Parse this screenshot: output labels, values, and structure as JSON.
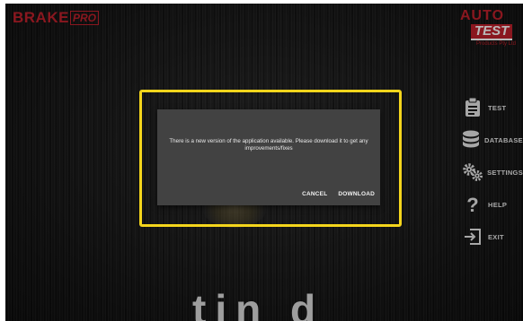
{
  "header": {
    "brand_main": "BRAKE",
    "brand_box": "PRO",
    "company": {
      "line1": "AUTO",
      "line2": "TEST",
      "line3": "Products Pty Ltd"
    }
  },
  "menu": [
    {
      "icon": "clipboard-icon",
      "label": "TEST"
    },
    {
      "icon": "database-icon",
      "label": "DATABASE"
    },
    {
      "icon": "gears-icon",
      "label": "SETTINGS"
    },
    {
      "icon": "question-icon",
      "label": "HELP"
    },
    {
      "icon": "exit-icon",
      "label": "EXIT"
    }
  ],
  "background_text": "tin d",
  "dialog": {
    "message": "There is a new version of the application available. Please download it to get any improvements/fixes",
    "cancel_label": "CANCEL",
    "download_label": "DOWNLOAD"
  },
  "colors": {
    "brand_red": "#c0212b",
    "highlight_yellow": "#f4d51c",
    "dialog_bg": "#424242"
  }
}
